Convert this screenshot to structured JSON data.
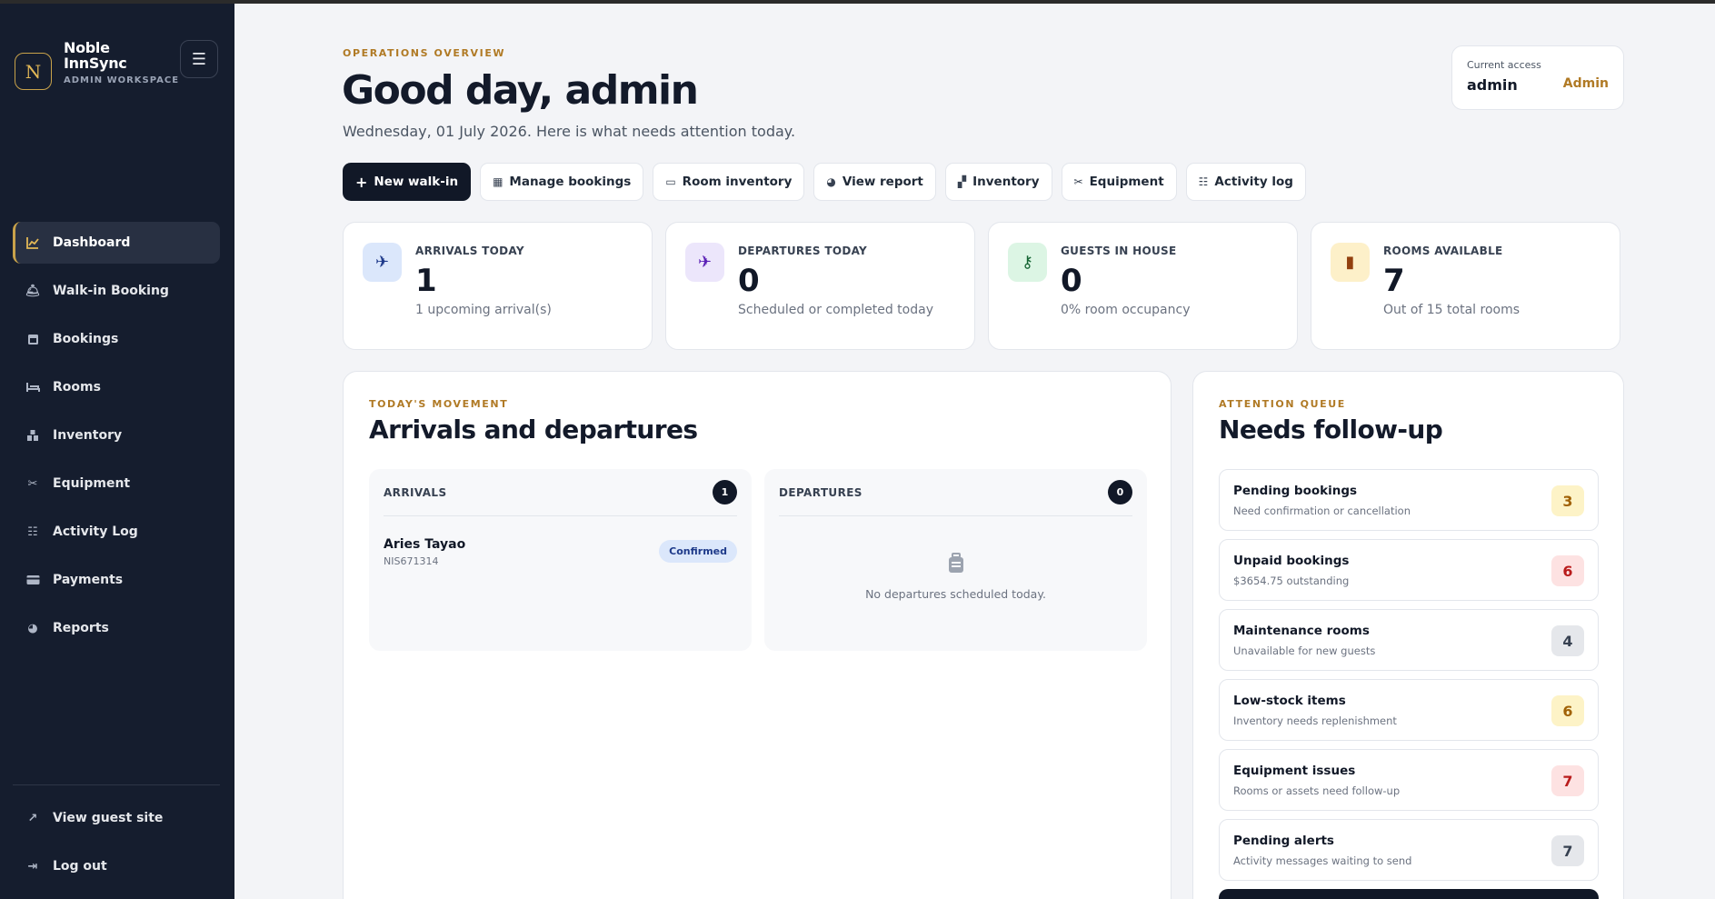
{
  "brand": {
    "logo_letter": "N",
    "name": "Noble InnSync",
    "subtitle": "ADMIN WORKSPACE"
  },
  "sidebar": {
    "items": [
      {
        "label": "Dashboard",
        "icon": "chart-line-icon",
        "active": true
      },
      {
        "label": "Walk-in Booking",
        "icon": "bell-icon"
      },
      {
        "label": "Bookings",
        "icon": "calendar-icon"
      },
      {
        "label": "Rooms",
        "icon": "bed-icon"
      },
      {
        "label": "Inventory",
        "icon": "boxes-icon"
      },
      {
        "label": "Equipment",
        "icon": "tools-icon"
      },
      {
        "label": "Activity Log",
        "icon": "list-icon"
      },
      {
        "label": "Payments",
        "icon": "card-icon"
      },
      {
        "label": "Reports",
        "icon": "pie-chart-icon"
      }
    ],
    "bottom": [
      {
        "label": "View guest site",
        "icon": "external-link-icon"
      },
      {
        "label": "Log out",
        "icon": "logout-icon"
      }
    ]
  },
  "header": {
    "eyebrow": "OPERATIONS OVERVIEW",
    "greeting": "Good day, admin",
    "date_line": "Wednesday, 01 July 2026. Here is what needs attention today."
  },
  "access": {
    "label": "Current access",
    "user": "admin",
    "role": "Admin"
  },
  "actions": [
    {
      "label": "New walk-in",
      "icon": "plus-icon",
      "primary": true
    },
    {
      "label": "Manage bookings",
      "icon": "calendar-icon"
    },
    {
      "label": "Room inventory",
      "icon": "bed-icon"
    },
    {
      "label": "View report",
      "icon": "pie-chart-icon"
    },
    {
      "label": "Inventory",
      "icon": "boxes-icon"
    },
    {
      "label": "Equipment",
      "icon": "tools-icon"
    },
    {
      "label": "Activity log",
      "icon": "list-icon"
    }
  ],
  "stats": [
    {
      "label": "ARRIVALS TODAY",
      "value": "1",
      "sub": "1 upcoming arrival(s)",
      "icon": "plane-arrival-icon",
      "bg": "#dbe7fb",
      "fg": "#1e3a8a"
    },
    {
      "label": "DEPARTURES TODAY",
      "value": "0",
      "sub": "Scheduled or completed today",
      "icon": "plane-departure-icon",
      "bg": "#ece6fb",
      "fg": "#5b21b6"
    },
    {
      "label": "GUESTS IN HOUSE",
      "value": "0",
      "sub": "0% room occupancy",
      "icon": "key-icon",
      "bg": "#dcf5e4",
      "fg": "#166534"
    },
    {
      "label": "ROOMS AVAILABLE",
      "value": "7",
      "sub": "Out of 15 total rooms",
      "icon": "door-icon",
      "bg": "#fdf0c9",
      "fg": "#92400e"
    }
  ],
  "movement": {
    "eyebrow": "TODAY'S MOVEMENT",
    "title": "Arrivals and departures",
    "arrivals": {
      "title": "ARRIVALS",
      "count": "1",
      "items": [
        {
          "name": "Aries Tayao",
          "code": "NIS671314",
          "status": "Confirmed"
        }
      ]
    },
    "departures": {
      "title": "DEPARTURES",
      "count": "0",
      "empty_text": "No departures scheduled today."
    }
  },
  "attention": {
    "eyebrow": "ATTENTION QUEUE",
    "title": "Needs follow-up",
    "items": [
      {
        "title": "Pending bookings",
        "sub": "Need confirmation or cancellation",
        "count": "3",
        "tone": "yellow"
      },
      {
        "title": "Unpaid bookings",
        "sub": "$3654.75 outstanding",
        "count": "6",
        "tone": "red"
      },
      {
        "title": "Maintenance rooms",
        "sub": "Unavailable for new guests",
        "count": "4",
        "tone": "gray"
      },
      {
        "title": "Low-stock items",
        "sub": "Inventory needs replenishment",
        "count": "6",
        "tone": "yellow"
      },
      {
        "title": "Equipment issues",
        "sub": "Rooms or assets need follow-up",
        "count": "7",
        "tone": "red"
      },
      {
        "title": "Pending alerts",
        "sub": "Activity messages waiting to send",
        "count": "7",
        "tone": "gray"
      }
    ]
  },
  "colors": {
    "sidebar_bg": "#151d2e",
    "accent_gold": "#b07a25",
    "primary_dark": "#111827"
  }
}
